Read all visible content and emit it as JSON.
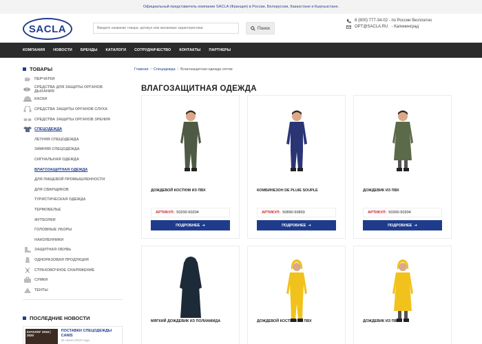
{
  "topbar": {
    "text": "Официальный представитель компании SACLA (Франция) в России, Белоруссии, Казахстане и Кыргызстане."
  },
  "header": {
    "logo_text": "SACLA",
    "search_placeholder": "Введите название товара, артикул или желаемые характеристики",
    "search_button": "Поиск",
    "phone": "8 (800) 777-34-02 - по России бесплатно",
    "email": "OPT@SACLA.RU",
    "city": "- Калининград"
  },
  "nav": {
    "items": [
      "Компания",
      "Новости",
      "Бренды",
      "Каталоги",
      "Сотрудничество",
      "Контакты",
      "Партнеры"
    ]
  },
  "sidebar": {
    "title": "Товары",
    "categories": [
      {
        "label": "Перчатки",
        "icon": "glove-icon",
        "level": 0,
        "active": false
      },
      {
        "label": "Средства для защиты органов дыхания",
        "icon": "respirator-icon",
        "level": 0,
        "active": false
      },
      {
        "label": "Каски",
        "icon": "helmet-icon",
        "level": 0,
        "active": false
      },
      {
        "label": "Средства защиты органов слуха",
        "icon": "earmuff-icon",
        "level": 0,
        "active": false
      },
      {
        "label": "Средства защиты органов зрения",
        "icon": "goggles-icon",
        "level": 0,
        "active": false
      },
      {
        "label": "Спецодежда",
        "icon": "clothing-icon",
        "level": 0,
        "active": true
      },
      {
        "label": "Летняя спецодежда",
        "level": 1,
        "active": false
      },
      {
        "label": "Зимняя спецодежда",
        "level": 1,
        "active": false
      },
      {
        "label": "Сигнальная одежда",
        "level": 1,
        "active": false
      },
      {
        "label": "Влагозащитная одежда",
        "level": 1,
        "active": true
      },
      {
        "label": "Для пищевой промышленности",
        "level": 1,
        "active": false
      },
      {
        "label": "Для сварщиков",
        "level": 1,
        "active": false
      },
      {
        "label": "Туристическая одежда",
        "level": 1,
        "active": false
      },
      {
        "label": "Термобелье",
        "level": 1,
        "active": false
      },
      {
        "label": "Футболки",
        "level": 1,
        "active": false
      },
      {
        "label": "Головные уборы",
        "level": 1,
        "active": false
      },
      {
        "label": "Наколенники",
        "level": 1,
        "active": false
      },
      {
        "label": "Защитная обувь",
        "icon": "boot-icon",
        "level": 0,
        "active": false
      },
      {
        "label": "Одноразовая продукция",
        "icon": "disposable-icon",
        "level": 0,
        "active": false
      },
      {
        "label": "Страховочное снаряжение",
        "icon": "harness-icon",
        "level": 0,
        "active": false
      },
      {
        "label": "Сумки",
        "icon": "bag-icon",
        "level": 0,
        "active": false
      },
      {
        "label": "Тенты",
        "icon": "tent-icon",
        "level": 0,
        "active": false
      }
    ],
    "news_title": "Последние новости",
    "news": [
      {
        "title": "Поставки спецодежды CANIS",
        "date": "01 июня 2019 года",
        "thumb_text": "КАТАЛОГ 2019 | 2020"
      }
    ]
  },
  "breadcrumb": {
    "home": "Главная",
    "section": "Спецодежда",
    "current": "Влагозащитная одежда оптом"
  },
  "page_title": "Влагозащитная одежда",
  "products": [
    {
      "name": "Дождевой костюм из ПВХ",
      "sku_label": "Артикул:",
      "sku": "50200-50204",
      "button": "Подробнее",
      "color": "#4e5a44",
      "kind": "suit"
    },
    {
      "name": "Комбинезон DE PLUIE SOUPLE",
      "sku_label": "Артикул:",
      "sku": "50890-50893",
      "button": "Подробнее",
      "color": "#2b3576",
      "kind": "coverall"
    },
    {
      "name": "Дождевик из ПВХ",
      "sku_label": "Артикул:",
      "sku": "50300-50304",
      "button": "Подробнее",
      "color": "#5b6b4a",
      "kind": "coat"
    },
    {
      "name": "Мягкий дождевик из полиамида",
      "color": "#1d2a38",
      "kind": "coat-only"
    },
    {
      "name": "Дождевой костюм из ПВХ",
      "color": "#f2c21c",
      "kind": "suit"
    },
    {
      "name": "Дождевик из ПВХ",
      "color": "#f2c21c",
      "kind": "coat"
    }
  ]
}
